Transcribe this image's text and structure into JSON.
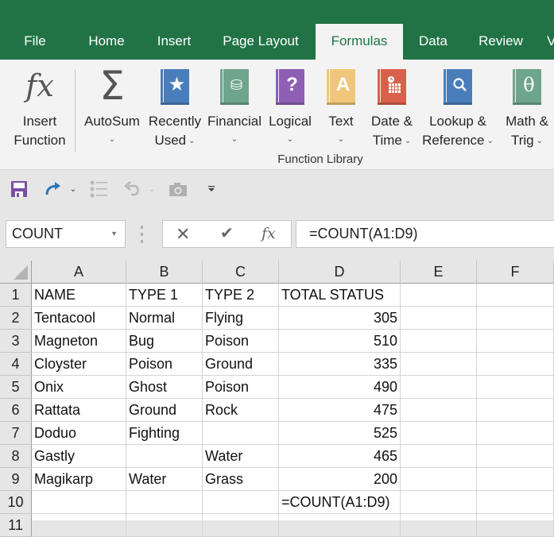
{
  "ribbon_tabs": [
    {
      "label": "File"
    },
    {
      "label": "Home"
    },
    {
      "label": "Insert"
    },
    {
      "label": "Page Layout"
    },
    {
      "label": "Formulas",
      "active": true
    },
    {
      "label": "Data"
    },
    {
      "label": "Review"
    }
  ],
  "ribbon": {
    "insert_function": {
      "line1": "Insert",
      "line2": "Function",
      "icon": "fx-icon"
    },
    "autosum": {
      "line1": "AutoSum",
      "icon": "sigma-icon"
    },
    "recently_used": {
      "line1": "Recently",
      "line2": "Used",
      "icon": "star-book-icon",
      "color": "#4a7ebb"
    },
    "financial": {
      "line1": "Financial",
      "icon": "coins-book-icon",
      "color": "#6fa58d"
    },
    "logical": {
      "line1": "Logical",
      "icon": "question-book-icon",
      "glyph": "?",
      "color": "#8e5fb5"
    },
    "text": {
      "line1": "Text",
      "icon": "letter-a-book-icon",
      "glyph": "A",
      "color": "#f0c77a"
    },
    "date_time": {
      "line1": "Date &",
      "line2": "Time",
      "icon": "calendar-book-icon",
      "color": "#d9604a"
    },
    "lookup_reference": {
      "line1": "Lookup &",
      "line2": "Reference",
      "icon": "magnifier-book-icon",
      "color": "#4a7ebb"
    },
    "math_trig": {
      "line1": "Math &",
      "line2": "Trig",
      "icon": "theta-book-icon",
      "glyph": "θ",
      "color": "#6fa58d"
    },
    "group_label": "Function Library"
  },
  "qat": {
    "save": "save-icon",
    "redo": "redo-icon",
    "list": "bullet-list-icon",
    "undo": "undo-icon",
    "camera": "camera-icon",
    "customize": "customize-qat-icon"
  },
  "formula_bar": {
    "name_box": "COUNT",
    "cancel": "✕",
    "enter": "✔",
    "fx": "fx",
    "formula": "=COUNT(A1:D9)"
  },
  "sheet": {
    "columns": [
      "A",
      "B",
      "C",
      "D",
      "E",
      "F"
    ],
    "rows": [
      "1",
      "2",
      "3",
      "4",
      "5",
      "6",
      "7",
      "8",
      "9",
      "10",
      "11"
    ],
    "cells": [
      [
        "NAME",
        "TYPE 1",
        "TYPE 2",
        "TOTAL STATUS",
        "",
        ""
      ],
      [
        "Tentacool",
        "Normal",
        "Flying",
        "305",
        "",
        ""
      ],
      [
        "Magneton",
        "Bug",
        "Poison",
        "510",
        "",
        ""
      ],
      [
        "Cloyster",
        "Poison",
        "Ground",
        "335",
        "",
        ""
      ],
      [
        "Onix",
        "Ghost",
        "Poison",
        "490",
        "",
        ""
      ],
      [
        "Rattata",
        "Ground",
        "Rock",
        "475",
        "",
        ""
      ],
      [
        "Doduo",
        "Fighting",
        "",
        "525",
        "",
        ""
      ],
      [
        "Gastly",
        "",
        "Water",
        "465",
        "",
        ""
      ],
      [
        "Magikarp",
        "Water",
        "Grass",
        "200",
        "",
        ""
      ],
      [
        "",
        "",
        "",
        "=COUNT(A1:D9)",
        "",
        ""
      ],
      [
        "",
        "",
        "",
        "",
        "",
        ""
      ]
    ]
  },
  "colors": {
    "excel_green": "#217346",
    "ribbon_bg": "#f3f3f3",
    "header_bg": "#e6e6e6"
  }
}
